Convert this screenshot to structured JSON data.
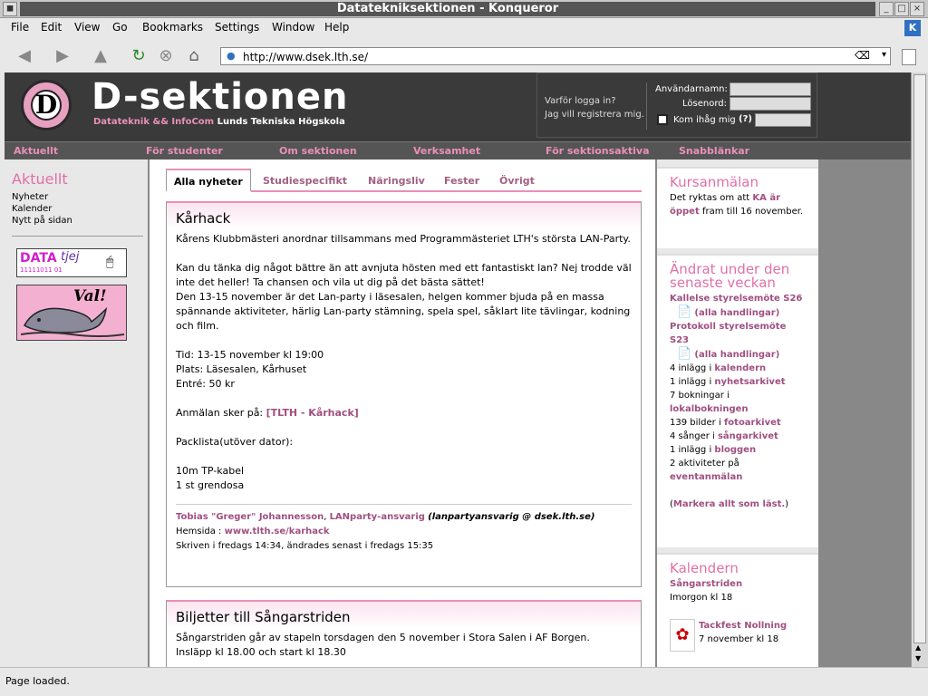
{
  "window": {
    "title": "Datateknik­sektionen - Konqueror"
  },
  "menu": [
    "File",
    "Edit",
    "View",
    "Go",
    "Bookmarks",
    "Settings",
    "Window",
    "Help"
  ],
  "toolbar": {
    "url": "http://www.dsek.lth.se/"
  },
  "site": {
    "title": "D-sektionen",
    "subtitle_pink": "Datateknik && InfoCom",
    "subtitle_white": "Lunds Tekniska Högskola",
    "logo_letter": "D"
  },
  "login": {
    "why": "Varför logga in?",
    "register": "Jag vill registrera mig.",
    "username_label": "Användarnamn:",
    "password_label": "Lösenord:",
    "remember_label": "Kom ihåg mig",
    "help": "(?)"
  },
  "nav": [
    "Aktuellt",
    "För studenter",
    "Om sektionen",
    "Verksamhet",
    "För sektionsaktiva",
    "Snabblänkar"
  ],
  "left": {
    "heading": "Aktuellt",
    "links": [
      "Nyheter",
      "Kalender",
      "Nytt på sidan"
    ],
    "datatjej": {
      "data": "DATA",
      "tjej": "tjej",
      "bits": "11111011 01"
    },
    "val": "Val!"
  },
  "tabs": [
    "Alla nyheter",
    "Studiespecifikt",
    "Näringsliv",
    "Fester",
    "Övrigt"
  ],
  "articles": {
    "a1": {
      "title": "Kårhack",
      "p1": "Kårens Klubbmästeri anordnar tillsammans med Programmästeriet LTH's största LAN-Party.",
      "p2": "Kan du tänka dig något bättre än att avnjuta hösten med ett fantastiskt lan? Nej trodde väl inte det heller! Ta chansen och vila ut dig på det bästa sättet!",
      "p3": "Den 13-15 november är det Lan-party i läsesalen, helgen kommer bjuda på en massa spännande aktiviteter, härlig Lan-party stämning, spela spel, såklart lite tävlingar, kodning och film.",
      "tid": "Tid: 13-15 november kl 19:00",
      "plats": "Plats: Läsesalen, Kårhuset",
      "entre": "Entré: 50 kr",
      "anmalan": "Anmälan sker på:",
      "anmalan_link": "[TLTH - Kårhack]",
      "packlista": "Packlista(utöver dator):",
      "item1": "10m TP-kabel",
      "item2": "1 st grendosa",
      "author": "Tobias \"Greger\" Johannesson",
      "role": "LANparty-ansvarig",
      "email": "(lanpartyansvarig @ dsek.lth.se)",
      "home_label": "Hemsida :",
      "home_link": "www.tlth.se/karhack",
      "written": "Skriven i fredags 14:34, ändrades senast i fredags 15:35"
    },
    "a2": {
      "title": "Biljetter till Sångarstriden",
      "p1": "Sångarstriden går av stapeln torsdagen den 5 november i Stora Salen i AF Borgen.",
      "p2": "Insläpp kl 18.00 och start kl 18.30"
    }
  },
  "right": {
    "kurs": {
      "heading": "Kursanmälan",
      "t1": "Det ryktas om att",
      "link": "KA är öppet",
      "t2": "fram till 16 november."
    },
    "andrat": {
      "heading": "Ändrat under den senaste veckan",
      "l1": "Kallelse styrelsemöte S26",
      "h1": "(alla handlingar)",
      "l2": "Protokoll styrelsemöte S23",
      "h2": "(alla handlingar)",
      "r1a": "4 inlägg i",
      "r1b": "kalendern",
      "r2a": "1 inlägg i",
      "r2b": "nyhetsarkivet",
      "r3a": "7 bokningar i",
      "r3b": "lokalbokningen",
      "r4a": "139 bilder i",
      "r4b": "fotoarkivet",
      "r5a": "4 sånger i",
      "r5b": "sångarkivet",
      "r6a": "1 inlägg i",
      "r6b": "bloggen",
      "r7a": "2 aktiviteter på",
      "r7b": "eventanmälan",
      "mark": "Markera allt som läst."
    },
    "kal": {
      "heading": "Kalendern",
      "e1": "Sångarstriden",
      "e1t": "Imorgon kl 18",
      "e2": "Tackfest Nollning",
      "e2t": "7 november kl 18"
    }
  },
  "status": "Page loaded.",
  "colors": {
    "pink": "#e890b8",
    "header": "#3a3a3a",
    "link": "#a05080"
  }
}
